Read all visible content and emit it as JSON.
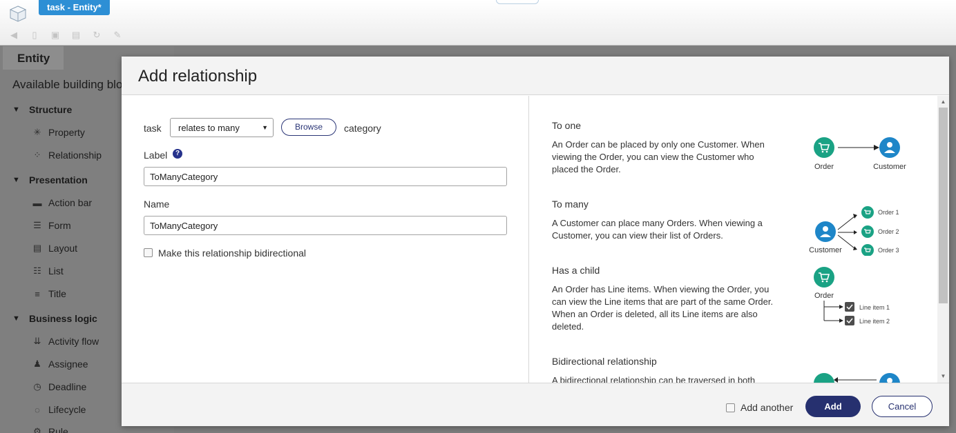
{
  "window": {
    "tab_title": "task - Entity*"
  },
  "toolbar": {
    "icons": [
      "back-icon",
      "new-icon",
      "save-icon",
      "save-all-icon",
      "refresh-icon",
      "edit-icon"
    ]
  },
  "sidebar": {
    "tab": "Entity",
    "heading": "Available building blocks",
    "sections": {
      "structure": "Structure",
      "presentation": "Presentation",
      "business_logic": "Business logic"
    },
    "items": {
      "property": "Property",
      "relationship": "Relationship",
      "action_bar": "Action bar",
      "form": "Form",
      "layout": "Layout",
      "list": "List",
      "title": "Title",
      "activity_flow": "Activity flow",
      "assignee": "Assignee",
      "deadline": "Deadline",
      "lifecycle": "Lifecycle",
      "rule": "Rule"
    }
  },
  "dialog": {
    "title": "Add relationship",
    "form": {
      "source_entity": "task",
      "relation_type": "relates to many",
      "browse_label": "Browse",
      "target_entity": "category",
      "label_caption": "Label",
      "label_value": "ToManyCategory",
      "name_caption": "Name",
      "name_value": "ToManyCategory",
      "bidirectional_label": "Make this relationship bidirectional"
    },
    "help": {
      "to_one": {
        "title": "To one",
        "body": "An Order can be placed by only one Customer. When viewing the Order, you can view the Customer who placed the Order.",
        "order": "Order",
        "customer": "Customer"
      },
      "to_many": {
        "title": "To many",
        "body": "A Customer can place many Orders. When viewing a Customer, you can view their list of Orders.",
        "customer": "Customer",
        "order1": "Order 1",
        "order2": "Order 2",
        "order3": "Order 3"
      },
      "has_child": {
        "title": "Has a child",
        "body": "An Order has Line items. When viewing the Order, you can view the Line items that are part of the same Order. When an Order is deleted, all its Line items are also deleted.",
        "order": "Order",
        "line1": "Line item 1",
        "line2": "Line item 2"
      },
      "bidirectional": {
        "title": "Bidirectional relationship",
        "body": "A bidirectional relationship can be traversed in both"
      }
    },
    "footer": {
      "add_another": "Add another",
      "add": "Add",
      "cancel": "Cancel"
    }
  },
  "colors": {
    "accent": "#26306f",
    "teal": "#1aa284",
    "blue": "#1e86c8",
    "tab_blue": "#2d8fd5"
  }
}
